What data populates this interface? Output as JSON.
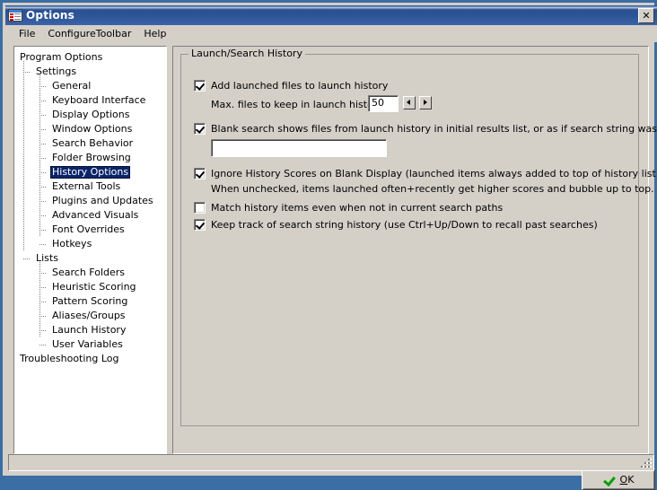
{
  "window": {
    "title": "Options",
    "icon": "options-window-icon",
    "close_label": "✕"
  },
  "menubar": {
    "items": [
      {
        "label": "File"
      },
      {
        "label": "ConfigureToolbar"
      },
      {
        "label": "Help"
      }
    ]
  },
  "tree": {
    "nodes": [
      {
        "label": "Program Options",
        "level": 0,
        "selected": false
      },
      {
        "label": "Settings",
        "level": 1,
        "selected": false
      },
      {
        "label": "General",
        "level": 2,
        "selected": false
      },
      {
        "label": "Keyboard Interface",
        "level": 2,
        "selected": false
      },
      {
        "label": "Display Options",
        "level": 2,
        "selected": false
      },
      {
        "label": "Window Options",
        "level": 2,
        "selected": false
      },
      {
        "label": "Search Behavior",
        "level": 2,
        "selected": false
      },
      {
        "label": "Folder Browsing",
        "level": 2,
        "selected": false
      },
      {
        "label": "History Options",
        "level": 2,
        "selected": true
      },
      {
        "label": "External Tools",
        "level": 2,
        "selected": false
      },
      {
        "label": "Plugins and Updates",
        "level": 2,
        "selected": false
      },
      {
        "label": "Advanced Visuals",
        "level": 2,
        "selected": false
      },
      {
        "label": "Font Overrides",
        "level": 2,
        "selected": false
      },
      {
        "label": "Hotkeys",
        "level": 2,
        "selected": false
      },
      {
        "label": "Lists",
        "level": 1,
        "selected": false
      },
      {
        "label": "Search Folders",
        "level": 2,
        "selected": false
      },
      {
        "label": "Heuristic Scoring",
        "level": 2,
        "selected": false
      },
      {
        "label": "Pattern Scoring",
        "level": 2,
        "selected": false
      },
      {
        "label": "Aliases/Groups",
        "level": 2,
        "selected": false
      },
      {
        "label": "Launch History",
        "level": 2,
        "selected": false
      },
      {
        "label": "User Variables",
        "level": 2,
        "selected": false
      },
      {
        "label": "Troubleshooting Log",
        "level": 0,
        "selected": false
      }
    ]
  },
  "panel": {
    "group_title": "Launch/Search History",
    "opt_add_launched": {
      "label": "Add launched files to launch history",
      "checked": true
    },
    "max_files": {
      "label": "Max. files to keep in launch history:",
      "value": "50",
      "spin_down_icon": "triangle-left-icon",
      "spin_up_icon": "triangle-right-icon"
    },
    "opt_blank_search": {
      "label": "Blank search shows files from launch history in initial results list, or as if search string was:",
      "checked": true
    },
    "blank_search_input": {
      "value": "",
      "placeholder": ""
    },
    "opt_ignore_scores": {
      "label": "Ignore History Scores on Blank Display (launched items always added to top of history list)",
      "checked": true,
      "note": "When unchecked, items launched often+recently get higher scores and bubble up to top."
    },
    "opt_match_history": {
      "label": "Match history items even when not in current search paths",
      "checked": false
    },
    "opt_keep_track": {
      "label": "Keep track of search string history (use Ctrl+Up/Down to recall past searches)",
      "checked": true
    }
  },
  "footer": {
    "ok_label_pre": "",
    "ok_label_accel": "O",
    "ok_label_post": "K",
    "ok_icon": "green-check-icon"
  },
  "statusbar": {
    "text": ""
  },
  "colors": {
    "title_bar": "#2d5596",
    "selection": "#0a246a",
    "face": "#d4d0c8",
    "ok_check": "#00a000"
  }
}
